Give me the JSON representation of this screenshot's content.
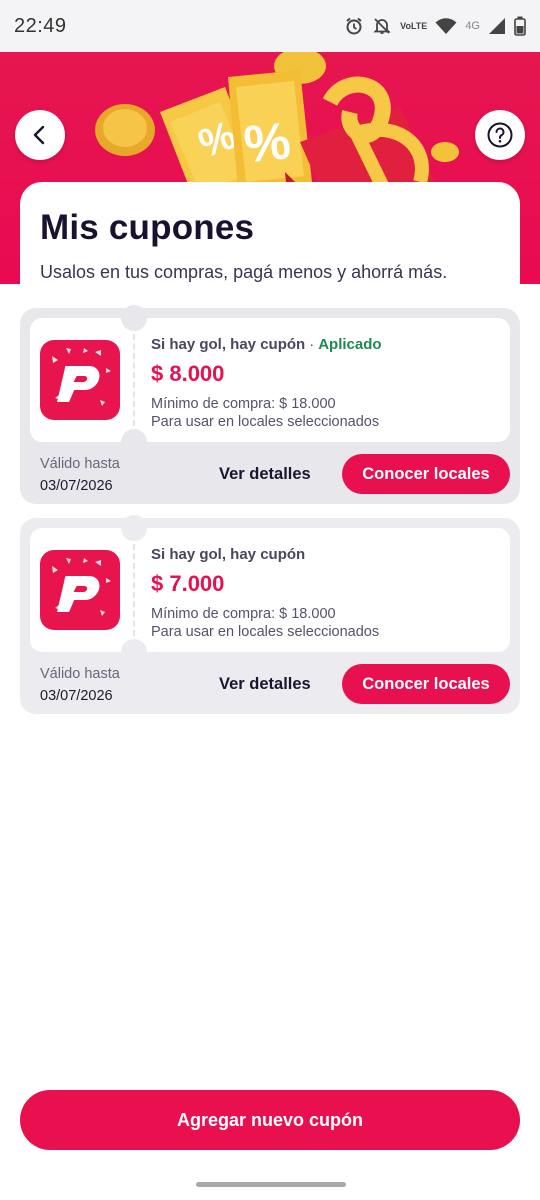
{
  "status_bar": {
    "time": "22:49",
    "volte_top": "Vo",
    "volte_bottom": "LTE",
    "network": "4G",
    "icons": [
      "alarm-icon",
      "bell-off-icon",
      "volte-icon",
      "wifi-icon",
      "signal-icon",
      "battery-icon"
    ]
  },
  "header": {
    "back_icon": "chevron-left-icon",
    "help_icon": "question-circle-icon",
    "illustration": "coupons-gift-illustration",
    "percent_symbol": "%"
  },
  "page": {
    "title": "Mis cupones",
    "subtitle": "Usalos en tus compras, pagá menos y ahorrá más."
  },
  "coupons": [
    {
      "name": "Si hay gol, hay cupón",
      "separator": "·",
      "status": "Aplicado",
      "amount": "$ 8.000",
      "min_purchase": "Mínimo de compra: $ 18.000",
      "scope": "Para usar en locales seleccionados",
      "valid_label": "Válido hasta",
      "valid_date": "03/07/2026",
      "details_label": "Ver detalles",
      "locales_label": "Conocer locales"
    },
    {
      "name": "Si hay gol, hay cupón",
      "status": "",
      "amount": "$ 7.000",
      "min_purchase": "Mínimo de compra: $ 18.000",
      "scope": "Para usar en locales seleccionados",
      "valid_label": "Válido hasta",
      "valid_date": "03/07/2026",
      "details_label": "Ver detalles",
      "locales_label": "Conocer locales"
    }
  ],
  "footer": {
    "add_label": "Agregar nuevo cupón"
  },
  "colors": {
    "brand": "#e8104e",
    "applied": "#1e8a52",
    "banner": "#e6164f"
  }
}
